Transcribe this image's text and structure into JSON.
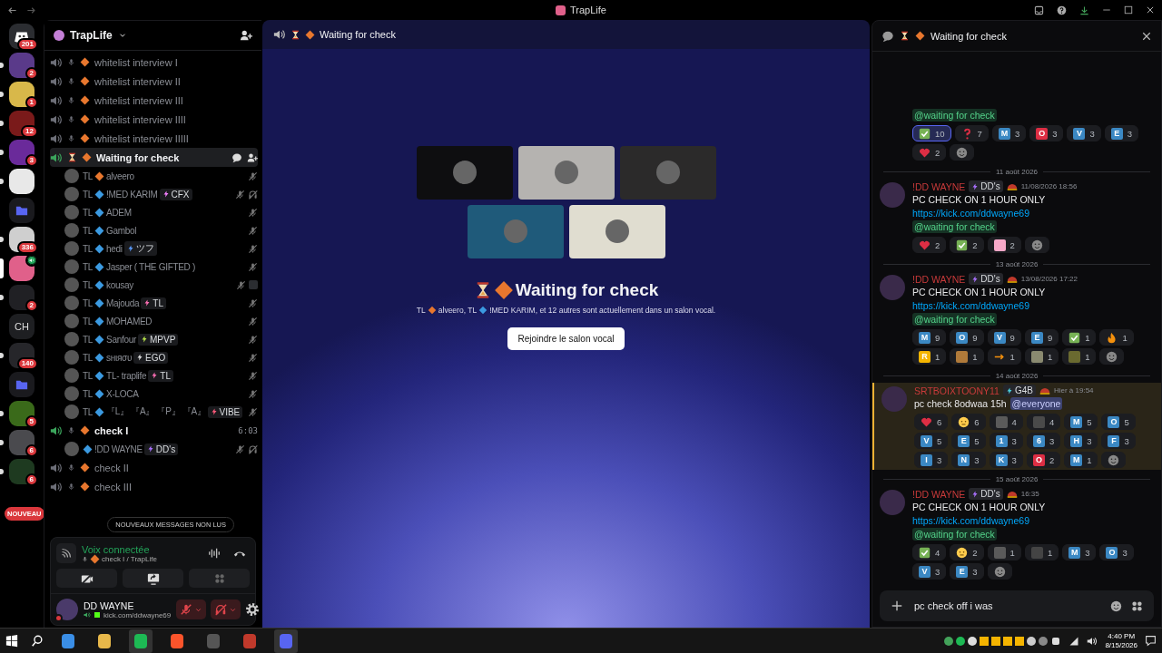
{
  "window": {
    "title": "TrapLife"
  },
  "servers": [
    {
      "kind": "home",
      "unread": false,
      "selected": false,
      "badge": "201"
    },
    {
      "kind": "image",
      "color": "#5a3a8a",
      "unread": true,
      "selected": false,
      "badge": "2"
    },
    {
      "kind": "image",
      "color": "#d8b84a",
      "unread": true,
      "selected": false,
      "badge": "1"
    },
    {
      "kind": "image",
      "color": "#7a1a1a",
      "unread": true,
      "selected": false,
      "badge": "12"
    },
    {
      "kind": "image",
      "color": "#6a2a9a",
      "unread": true,
      "selected": false,
      "badge": "3"
    },
    {
      "kind": "image",
      "color": "#e8e8e8",
      "unread": true,
      "selected": false
    },
    {
      "kind": "folder",
      "unread": false,
      "selected": false
    },
    {
      "kind": "image",
      "color": "#cfcfcf",
      "unread": true,
      "selected": false,
      "badge": "336"
    },
    {
      "kind": "image",
      "color": "#e0608a",
      "unread": false,
      "selected": true,
      "voice": true
    },
    {
      "kind": "image",
      "color": "#202024",
      "unread": true,
      "selected": false,
      "badge": "2"
    },
    {
      "kind": "text",
      "label": "CH",
      "unread": false,
      "selected": false
    },
    {
      "kind": "image",
      "color": "#26262a",
      "unread": true,
      "selected": false,
      "badge": "140"
    },
    {
      "kind": "folder",
      "unread": false,
      "selected": false
    },
    {
      "kind": "image",
      "color": "#3a6a1a",
      "unread": true,
      "selected": false,
      "badge": "5"
    },
    {
      "kind": "image",
      "color": "#4a4a4e",
      "unread": true,
      "selected": false,
      "badge": "6"
    },
    {
      "kind": "image",
      "color": "#1e3a20",
      "unread": true,
      "selected": false,
      "badge": "6"
    }
  ],
  "new_pill": "NOUVEAU",
  "guild": {
    "name": "TrapLife"
  },
  "channels": [
    {
      "kind": "mic",
      "name": "whitelist interview I",
      "active": false,
      "selected": false
    },
    {
      "kind": "mic",
      "name": "whitelist interview II",
      "active": false,
      "selected": false
    },
    {
      "kind": "mic",
      "name": "whitelist interview III",
      "active": false,
      "selected": false
    },
    {
      "kind": "mic",
      "name": "whitelist interview IIII",
      "active": false,
      "selected": false
    },
    {
      "kind": "mic",
      "name": "whitelist interview IIIII",
      "active": false,
      "selected": false
    },
    {
      "kind": "hourglass",
      "name": "Waiting for check",
      "active": true,
      "selected": true,
      "members": [
        {
          "prefix": "TL",
          "color": "#e8772e",
          "name": "alveero",
          "deafened": false
        },
        {
          "prefix": "TL",
          "color": "#3b9ae1",
          "name": "!MED KARIM",
          "tag": {
            "text": "CFX",
            "color": "#f47fff"
          },
          "deafened": true
        },
        {
          "prefix": "TL",
          "color": "#3b9ae1",
          "name": "ADEM",
          "deafened": false
        },
        {
          "prefix": "TL",
          "color": "#3b9ae1",
          "name": "Gambol",
          "deafened": false
        },
        {
          "prefix": "TL",
          "color": "#3b9ae1",
          "name": "hedi",
          "tag": {
            "text": "ツフ",
            "color": "#5a9bff"
          },
          "deafened": false
        },
        {
          "prefix": "TL",
          "color": "#3b9ae1",
          "name": "Jasper ( THE GIFTED )",
          "deafened": false
        },
        {
          "prefix": "TL",
          "color": "#3b9ae1",
          "name": "kousay",
          "deafened": false,
          "activity": true
        },
        {
          "prefix": "TL",
          "color": "#3b9ae1",
          "name": "Majouda",
          "tag": {
            "text": "TL",
            "color": "#ff6fb5"
          },
          "deafened": false
        },
        {
          "prefix": "TL",
          "color": "#3b9ae1",
          "name": "MOHAMED",
          "deafened": false
        },
        {
          "prefix": "TL",
          "color": "#3b9ae1",
          "name": "Sanfour",
          "tag": {
            "text": "MPVP",
            "color": "#b5e04a"
          },
          "deafened": false
        },
        {
          "prefix": "TL",
          "color": "#3b9ae1",
          "name": "ѕнιяσυ",
          "tag": {
            "text": "EGO",
            "color": "#dddddd"
          },
          "deafened": false
        },
        {
          "prefix": "TL",
          "color": "#3b9ae1",
          "name": "TL- traplife",
          "tag": {
            "text": "TL",
            "color": "#ff6fb5"
          },
          "deafened": false
        },
        {
          "prefix": "TL",
          "color": "#3b9ae1",
          "name": "X-LOCA",
          "deafened": false
        },
        {
          "prefix": "TL",
          "color": "#3b9ae1",
          "name": "『L』 『A』 『P』 『A』",
          "tag": {
            "text": "VIBE",
            "color": "#ff5a7a"
          },
          "deafened": false
        }
      ]
    },
    {
      "kind": "mic",
      "name": "check I",
      "active": true,
      "selected": false,
      "time": "6:03",
      "members": [
        {
          "color": "#3b9ae1",
          "name": "!DD WAYNE",
          "tag": {
            "text": "DD's",
            "color": "#a970ff"
          },
          "deafened": true
        }
      ]
    },
    {
      "kind": "mic",
      "name": "check II",
      "active": false,
      "selected": false
    },
    {
      "kind": "mic",
      "name": "check III",
      "active": false,
      "selected": false
    }
  ],
  "unread_pill": "NOUVEAUX MESSAGES NON LUS",
  "voice": {
    "status": "Voix connectée",
    "channel": "check I / TrapLife"
  },
  "user": {
    "name": "DD WAYNE",
    "activity": "kick.com/ddwayne69",
    "muted": true,
    "deafened": true
  },
  "center": {
    "header_title": "Waiting for check",
    "title": "Waiting for check",
    "tiles": [
      {
        "color": "#0e0e10"
      },
      {
        "color": "#b5b3b0"
      },
      {
        "color": "#2b2a2a"
      },
      {
        "color": "#1f5a7a"
      },
      {
        "color": "#e0ddd0"
      }
    ],
    "note": [
      {
        "text": "TL",
        "color": "#e8772e"
      },
      {
        "text": "alveero, TL",
        "color": "#3b9ae1"
      },
      {
        "text": "!MED KARIM, et 12 autres sont actuellement dans un salon vocal."
      }
    ],
    "button": "Rejoindre le salon vocal"
  },
  "chat": {
    "title": "Waiting for check",
    "feed": [
      {
        "kind": "message",
        "highlighted": false,
        "lines": [
          [
            {
              "kind": "mention",
              "text": "@waiting for check"
            }
          ]
        ],
        "reactions": [
          {
            "kind": "check",
            "count": "10",
            "selected": true
          },
          {
            "kind": "question",
            "count": "7",
            "selected": false
          },
          {
            "kind": "letter",
            "letter": "M",
            "color": "#3b88c3",
            "count": "3",
            "selected": false
          },
          {
            "kind": "letter",
            "letter": "O",
            "color": "#dd2e44",
            "count": "3",
            "selected": false
          },
          {
            "kind": "letter",
            "letter": "V",
            "color": "#3b88c3",
            "count": "3",
            "selected": false
          },
          {
            "kind": "letter",
            "letter": "E",
            "color": "#3b88c3",
            "count": "3",
            "selected": false
          },
          {
            "kind": "heart",
            "count": "2",
            "selected": false
          },
          {
            "kind": "add"
          }
        ]
      },
      {
        "kind": "divider",
        "text": "11 août 2026"
      },
      {
        "kind": "message",
        "highlighted": false,
        "author": "!DD WAYNE",
        "tag": {
          "text": "DD's",
          "color": "#a970ff"
        },
        "time": "11/08/2026 18:56",
        "lines": [
          [
            {
              "kind": "text",
              "text": "PC CHECK ON 1 HOUR ONLY"
            }
          ],
          [
            {
              "kind": "link",
              "text": "https://kick.com/ddwayne69"
            }
          ],
          [
            {
              "kind": "mention",
              "text": "@waiting for check"
            }
          ]
        ],
        "reactions": [
          {
            "kind": "heart",
            "count": "2",
            "selected": false
          },
          {
            "kind": "check",
            "count": "2",
            "selected": false
          },
          {
            "kind": "custom",
            "color": "#f7a8c8",
            "count": "2",
            "selected": false
          },
          {
            "kind": "add"
          }
        ]
      },
      {
        "kind": "divider",
        "text": "13 août 2026"
      },
      {
        "kind": "message",
        "highlighted": false,
        "author": "!DD WAYNE",
        "tag": {
          "text": "DD's",
          "color": "#a970ff"
        },
        "time": "13/08/2026 17:22",
        "lines": [
          [
            {
              "kind": "text",
              "text": "PC CHECK ON 1 HOUR ONLY"
            }
          ],
          [
            {
              "kind": "link",
              "text": "https://kick.com/ddwayne69"
            }
          ],
          [
            {
              "kind": "mention",
              "text": "@waiting for check"
            }
          ]
        ],
        "reactions": [
          {
            "kind": "letter",
            "letter": "M",
            "color": "#3b88c3",
            "count": "9",
            "selected": false
          },
          {
            "kind": "letter",
            "letter": "O",
            "color": "#3b88c3",
            "count": "9",
            "selected": false
          },
          {
            "kind": "letter",
            "letter": "V",
            "color": "#3b88c3",
            "count": "9",
            "selected": false
          },
          {
            "kind": "letter",
            "letter": "E",
            "color": "#3b88c3",
            "count": "9",
            "selected": false
          },
          {
            "kind": "check",
            "count": "1",
            "selected": false
          },
          {
            "kind": "fire",
            "count": "1",
            "selected": false
          },
          {
            "kind": "letter",
            "letter": "R",
            "color": "#f4b400",
            "count": "1",
            "selected": false
          },
          {
            "kind": "custom",
            "color": "#b07a3a",
            "count": "1",
            "selected": false
          },
          {
            "kind": "arrow",
            "count": "1",
            "selected": false
          },
          {
            "kind": "custom",
            "color": "#8a8a70",
            "count": "1",
            "selected": false
          },
          {
            "kind": "custom",
            "color": "#6a6a30",
            "count": "1",
            "selected": false
          },
          {
            "kind": "add"
          }
        ]
      },
      {
        "kind": "divider",
        "text": "14 août 2026"
      },
      {
        "kind": "message",
        "highlighted": true,
        "author": "SRTBOIXTOONY11",
        "tag": {
          "text": "G4B",
          "color": "#4ad0e0"
        },
        "time": "Hier à 19:54",
        "lines": [
          [
            {
              "kind": "text",
              "text": "pc check 8odwaa 15h"
            },
            {
              "kind": "everyone",
              "text": "@everyone"
            }
          ]
        ],
        "reactions": [
          {
            "kind": "heart",
            "count": "6",
            "selected": false
          },
          {
            "kind": "face",
            "count": "6",
            "selected": false
          },
          {
            "kind": "custom",
            "color": "#5a5a5a",
            "count": "4",
            "selected": false
          },
          {
            "kind": "custom",
            "color": "#4a4a4a",
            "count": "4",
            "selected": false
          },
          {
            "kind": "letter",
            "letter": "M",
            "color": "#3b88c3",
            "count": "5",
            "selected": false
          },
          {
            "kind": "letter",
            "letter": "O",
            "color": "#3b88c3",
            "count": "5",
            "selected": false
          },
          {
            "kind": "letter",
            "letter": "V",
            "color": "#3b88c3",
            "count": "5",
            "selected": false
          },
          {
            "kind": "letter",
            "letter": "E",
            "color": "#3b88c3",
            "count": "5",
            "selected": false
          },
          {
            "kind": "letter",
            "letter": "1",
            "color": "#3b88c3",
            "count": "3",
            "selected": false
          },
          {
            "kind": "letter",
            "letter": "6",
            "color": "#3b88c3",
            "count": "3",
            "selected": false
          },
          {
            "kind": "letter",
            "letter": "H",
            "color": "#3b88c3",
            "count": "3",
            "selected": false
          },
          {
            "kind": "letter",
            "letter": "F",
            "color": "#3b88c3",
            "count": "3",
            "selected": false
          },
          {
            "kind": "letter",
            "letter": "I",
            "color": "#3b88c3",
            "count": "3",
            "selected": false
          },
          {
            "kind": "letter",
            "letter": "N",
            "color": "#3b88c3",
            "count": "3",
            "selected": false
          },
          {
            "kind": "letter",
            "letter": "K",
            "color": "#3b88c3",
            "count": "3",
            "selected": false
          },
          {
            "kind": "letter",
            "letter": "O",
            "color": "#dd2e44",
            "count": "2",
            "selected": false
          },
          {
            "kind": "letter",
            "letter": "M",
            "color": "#3b88c3",
            "count": "1",
            "selected": false
          },
          {
            "kind": "add"
          }
        ]
      },
      {
        "kind": "divider",
        "text": "15 août 2026"
      },
      {
        "kind": "message",
        "highlighted": false,
        "author": "!DD WAYNE",
        "tag": {
          "text": "DD's",
          "color": "#a970ff"
        },
        "time": "16:35",
        "lines": [
          [
            {
              "kind": "text",
              "text": "PC CHECK ON 1 HOUR ONLY"
            }
          ],
          [
            {
              "kind": "link",
              "text": "https://kick.com/ddwayne69"
            }
          ],
          [
            {
              "kind": "mention",
              "text": "@waiting for check"
            }
          ]
        ],
        "reactions": [
          {
            "kind": "check",
            "count": "4",
            "selected": false
          },
          {
            "kind": "face",
            "count": "2",
            "selected": false
          },
          {
            "kind": "custom",
            "color": "#5a5a5a",
            "count": "1",
            "selected": false
          },
          {
            "kind": "custom",
            "color": "#444444",
            "count": "1",
            "selected": false
          },
          {
            "kind": "letter",
            "letter": "M",
            "color": "#3b88c3",
            "count": "3",
            "selected": false
          },
          {
            "kind": "letter",
            "letter": "O",
            "color": "#3b88c3",
            "count": "3",
            "selected": false
          },
          {
            "kind": "letter",
            "letter": "V",
            "color": "#3b88c3",
            "count": "3",
            "selected": false
          },
          {
            "kind": "letter",
            "letter": "E",
            "color": "#3b88c3",
            "count": "3",
            "selected": false
          },
          {
            "kind": "add"
          }
        ]
      }
    ],
    "input": {
      "value": "pc check off i was"
    }
  },
  "taskbar": {
    "apps": [
      {
        "color": "#3a8ee6",
        "selected": false
      },
      {
        "color": "#e8b84a",
        "selected": false
      },
      {
        "color": "#1db954",
        "selected": true
      },
      {
        "color": "#fb542b",
        "selected": false
      },
      {
        "color": "#555555",
        "selected": false
      },
      {
        "color": "#c0392b",
        "selected": false
      },
      {
        "color": "#5865f2",
        "selected": true
      }
    ],
    "time": "4:40 PM",
    "date": "8/15/2026"
  }
}
